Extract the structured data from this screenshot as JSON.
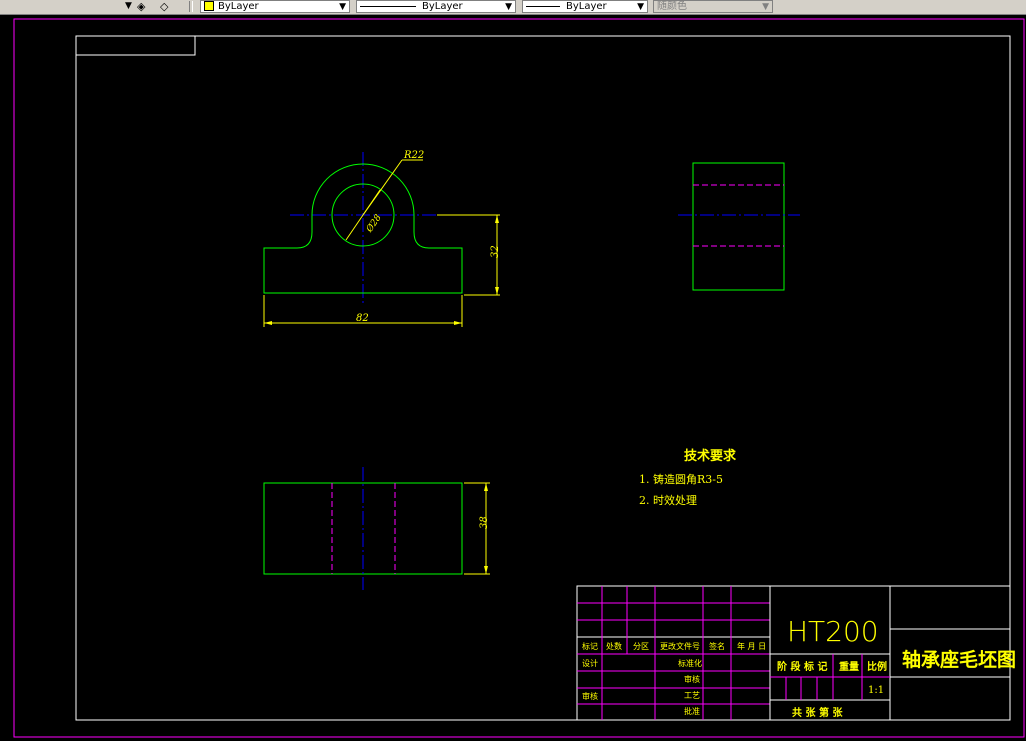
{
  "toolbar": {
    "color_label": "ByLayer",
    "linetype_label": "ByLayer",
    "lineweight_label": "ByLayer",
    "plotstyle_label": "随颜色"
  },
  "drawing": {
    "dim_radius": "R22",
    "dim_diameter": "Ø28",
    "dim_width": "82",
    "dim_height": "32",
    "dim_depth": "38",
    "tech_title": "技术要求",
    "tech_req_1": "1. 铸造圆角R3-5",
    "tech_req_2": "2. 时效处理"
  },
  "title_block": {
    "material": "HT200",
    "part_name": "轴承座毛坯图",
    "col_tag": "标记",
    "col_count": "处数",
    "col_zone": "分区",
    "col_doc": "更改文件号",
    "col_sign": "签名",
    "col_date": "年 月 日",
    "row_design": "设计",
    "row_standard": "标准化",
    "row_check": "审核",
    "row_process": "工艺",
    "row_review": "审核",
    "row_approve": "批准",
    "stage_label": "阶 段 标 记",
    "weight_label": "重量",
    "scale_label": "比例",
    "scale_value": "1:1",
    "sheet_label": "共  张  第  张"
  },
  "colors": {
    "outline": "#00ff00",
    "centerline": "#0000ff",
    "dimension": "#ffff00",
    "hidden": "#ff00ff",
    "frame": "#ffffff",
    "grid": "#ff00ff"
  }
}
